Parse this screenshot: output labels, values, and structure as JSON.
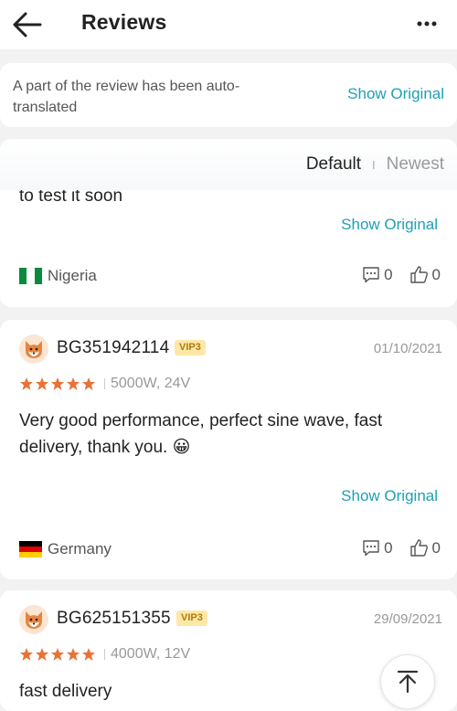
{
  "header": {
    "title": "Reviews"
  },
  "translation": {
    "notice": "A part of the review has been auto-translated",
    "show_original": "Show Original"
  },
  "sort": {
    "options": [
      "Default",
      "Newest"
    ],
    "separator": "I",
    "active": "Default"
  },
  "reviews": [
    {
      "text": "to test it soon",
      "show_original": "Show Original",
      "country": "Nigeria",
      "flag_colors": [
        "#0a8a3d",
        "#ffffff",
        "#0a8a3d"
      ],
      "comments": "0",
      "likes": "0"
    },
    {
      "username": "BG351942114",
      "badge": "VIP3",
      "date": "01/10/2021",
      "stars": 5,
      "separator": "I",
      "variant": "5000W, 24V",
      "text": "Very good performance, perfect sine wave, fast delivery, thank you. 😀",
      "show_original": "Show Original",
      "country": "Germany",
      "flag_colors": [
        "#000000",
        "#dd0000",
        "#ffce00"
      ],
      "comments": "0",
      "likes": "0"
    },
    {
      "username": "BG625151355",
      "badge": "VIP3",
      "date": "29/09/2021",
      "stars": 5,
      "separator": "I",
      "variant": "4000W, 12V",
      "text": "fast delivery"
    }
  ],
  "colors": {
    "accent": "#1e9fb8",
    "star": "#e8733a",
    "badge_bg": "#fde8a8",
    "badge_text": "#b07a10"
  },
  "icons": {
    "back": "arrow-left-icon",
    "more": "more-dots-icon",
    "comment": "comment-icon",
    "like": "thumbs-up-icon",
    "avatar": "fox-avatar-icon",
    "star": "star-icon",
    "scroll_top": "arrow-up-icon"
  }
}
